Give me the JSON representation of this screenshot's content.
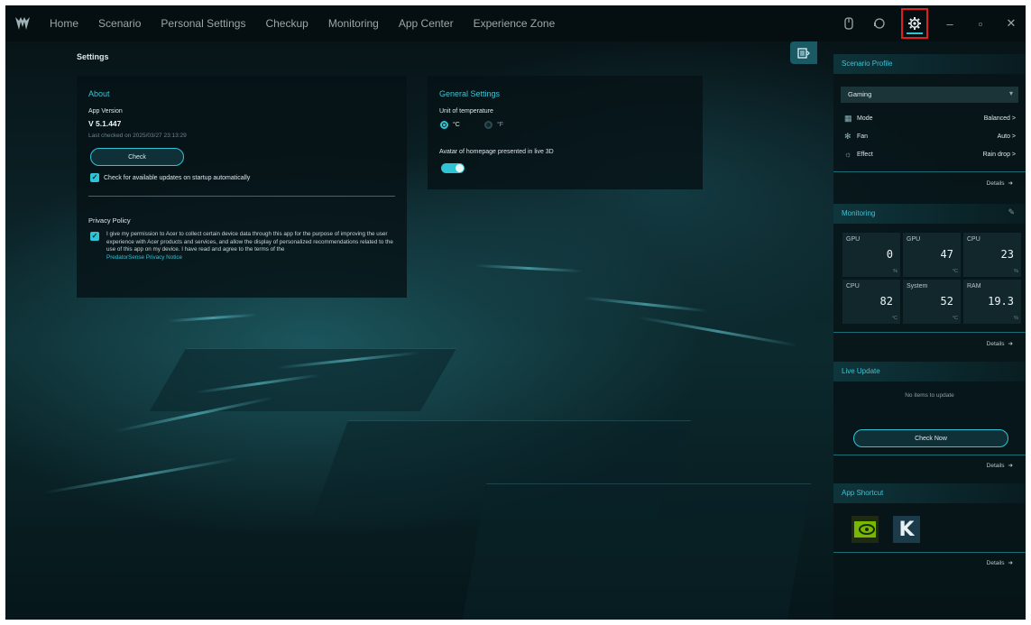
{
  "nav": {
    "items": [
      "Home",
      "Scenario",
      "Personal Settings",
      "Checkup",
      "Monitoring",
      "App Center",
      "Experience Zone"
    ]
  },
  "settings": {
    "title": "Settings",
    "about": {
      "title": "About",
      "app_version_label": "App Version",
      "app_version": "V 5.1.447",
      "last_checked": "Last checked on 2025/03/27 23:13:29",
      "check_label": "Check",
      "auto_update_label": "Check for available updates on startup automatically"
    },
    "privacy": {
      "title": "Privacy Policy",
      "text": "I give my permission to Acer to collect certain device data through this app for the purpose of improving the user experience with Acer products and services, and allow the display of personalized recommendations related to the use of this app on my device. I have read and agree to the terms of the",
      "link": "PredatorSense Privacy Notice"
    },
    "general": {
      "title": "General Settings",
      "temp_label": "Unit of temperature",
      "celsius": "°C",
      "fahrenheit": "°F",
      "avatar_label": "Avatar of homepage presented in live 3D"
    }
  },
  "sidebar": {
    "scenario": {
      "title": "Scenario Profile",
      "selected": "Gaming",
      "rows": [
        {
          "label": "Mode",
          "value": "Balanced >"
        },
        {
          "label": "Fan",
          "value": "Auto >"
        },
        {
          "label": "Effect",
          "value": "Rain drop >"
        }
      ],
      "details": "Details"
    },
    "monitoring": {
      "title": "Monitoring",
      "tiles": [
        {
          "name": "GPU",
          "value": "0",
          "unit": "%"
        },
        {
          "name": "GPU",
          "value": "47",
          "unit": "°C"
        },
        {
          "name": "CPU",
          "value": "23",
          "unit": "%"
        },
        {
          "name": "CPU",
          "value": "82",
          "unit": "°C"
        },
        {
          "name": "System",
          "value": "52",
          "unit": "°C"
        },
        {
          "name": "RAM",
          "value": "19.3",
          "unit": "%"
        }
      ],
      "details": "Details"
    },
    "live_update": {
      "title": "Live Update",
      "status": "No items to update",
      "check_now": "Check Now",
      "details": "Details"
    },
    "shortcuts": {
      "title": "App Shortcut",
      "details": "Details"
    }
  },
  "colors": {
    "accent": "#2ec4d6",
    "highlight_box": "#e02020"
  }
}
